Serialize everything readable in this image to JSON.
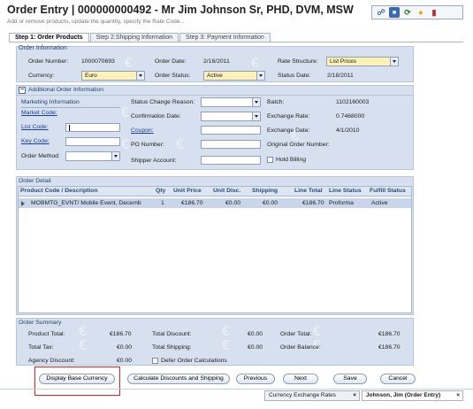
{
  "header": {
    "title": "Order Entry | 000000000492 - Mr Jim Johnson Sr, PHD, DVM, MSW",
    "subtitle": "Add or remove products, update the quantity, specify the Rate Code..."
  },
  "toolbar_icons": [
    "link-icon",
    "save-icon",
    "refresh-icon",
    "lightbulb-icon",
    "delete-icon"
  ],
  "tabs": [
    "Step 1: Order Products",
    "Step 2:Shipping Information",
    "Step 3: Payment Information"
  ],
  "order_info": {
    "section_title": "Order Information",
    "order_number_label": "Order Number:",
    "order_number": "1000070693",
    "order_date_label": "Order Date:",
    "order_date": "2/16/2011",
    "rate_structure_label": "Rate Structure:",
    "rate_structure": "List Prices",
    "currency_label": "Currency:",
    "currency": "Euro",
    "order_status_label": "Order Status:",
    "order_status": "Active",
    "status_date_label": "Status Date:",
    "status_date": "2/18/2011"
  },
  "additional": {
    "section_title": "Additional Order Information",
    "marketing_information": "Marketing Information",
    "market_code_label": "Market Code:",
    "list_code_label": "List Code:",
    "key_code_label": "Key Code:",
    "order_method_label": "Order Method:",
    "status_change_reason_label": "Status Change Reason:",
    "confirmation_date_label": "Confirmation Date:",
    "coupon_label": "Coupon:",
    "po_number_label": "PO Number:",
    "shipper_account_label": "Shipper Account:",
    "batch_label": "Batch:",
    "batch": "1102160003",
    "exchange_rate_label": "Exchange Rate:",
    "exchange_rate": "0.7468000",
    "exchange_date_label": "Exchange Date:",
    "exchange_date": "4/1/2010",
    "original_order_number_label": "Original Order Number:",
    "hold_billing_label": "Hold Billing"
  },
  "order_detail": {
    "section_title": "Order Detail",
    "columns": [
      "Product Code / Description",
      "Qty",
      "Unit Price",
      "Unit Disc.",
      "Shipping",
      "Line Total",
      "Line Status",
      "Fulfill Status"
    ],
    "rows": [
      [
        "MOBMTG_EVNT/ Mobile Event, Decemb",
        "1",
        "€186.70",
        "€0.00",
        "€0.00",
        "€186.70",
        "Proforma",
        "Active"
      ]
    ]
  },
  "summary": {
    "section_title": "Order Summary",
    "product_total_label": "Product Total:",
    "product_total": "€186.70",
    "total_tax_label": "Total Tax:",
    "total_tax": "€0.00",
    "agency_discount_label": "Agency Discount:",
    "agency_discount": "€0.00",
    "total_discount_label": "Total Discount:",
    "total_discount": "€0.00",
    "total_shipping_label": "Total Shipping:",
    "total_shipping": "€0.00",
    "defer_label": "Defer Order Calculations",
    "order_total_label": "Order Total:",
    "order_total": "€186.70",
    "order_balance_label": "Order Balance:",
    "order_balance": "€186.70"
  },
  "buttons": {
    "display_base_currency": "Display Base Currency",
    "calc": "Calculate Discounts and Shipping",
    "previous": "Previous",
    "next": "Next",
    "save": "Save",
    "cancel": "Cancel"
  },
  "footer_tabs": [
    "Currency Exchange Rates",
    "Johnson, Jim (Order Entry)"
  ],
  "colors": {
    "panel": "#d6e0ef",
    "header_text": "#24436c",
    "highlight": "#e02020",
    "yellow_field": "#fdf2b5"
  }
}
